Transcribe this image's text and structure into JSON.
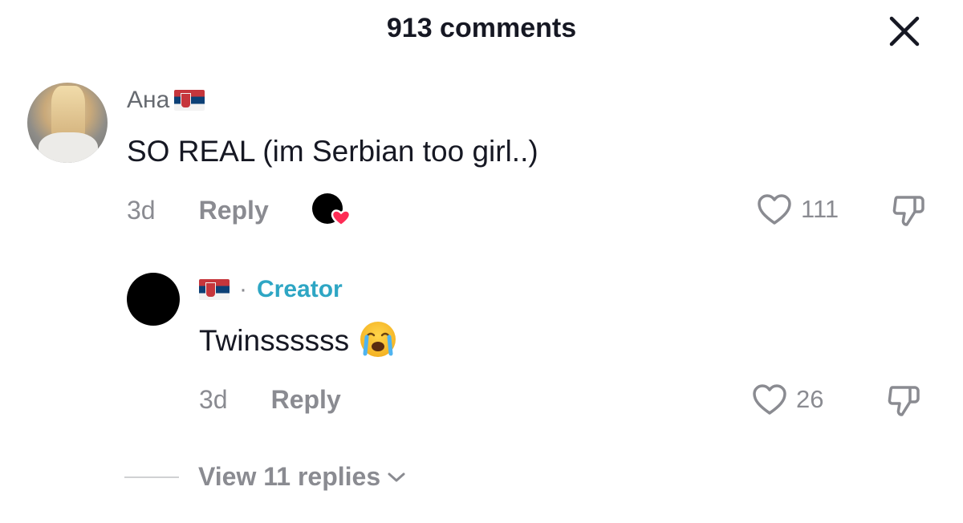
{
  "header": {
    "title": "913 comments"
  },
  "comments": [
    {
      "username": "Ана",
      "text": "SO REAL (im Serbian too girl..)",
      "time": "3d",
      "reply_label": "Reply",
      "likes": "111"
    }
  ],
  "reply": {
    "separator": "·",
    "creator_label": "Creator",
    "text": "Twinssssss",
    "time": "3d",
    "reply_label": "Reply",
    "likes": "26"
  },
  "view_replies": {
    "label": "View 11 replies"
  },
  "colors": {
    "creator": "#2ea6c4",
    "muted": "#8a8b91",
    "liked_heart": "#fe2c55"
  },
  "icons": {
    "close": "close-icon",
    "heart": "heart-icon",
    "dislike": "thumbs-down-icon",
    "emoji": "loudly-crying-face-emoji",
    "flag": "serbia-flag-emoji"
  }
}
